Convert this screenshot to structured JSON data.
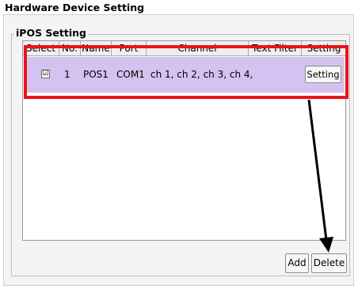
{
  "outer_title": "Hardware Device Setting",
  "group_title": "iPOS Setting",
  "columns": [
    "Select",
    "No.",
    "Name",
    "Port",
    "Channel",
    "Text Filter",
    "Setting"
  ],
  "row": {
    "checked_mark": "☑",
    "no": "1",
    "name": "POS1",
    "port": "COM1",
    "channel": "ch 1, ch 2, ch 3, ch 4,",
    "text_filter": "",
    "setting_label": "Setting"
  },
  "buttons": {
    "add": "Add",
    "delete": "Delete"
  },
  "colors": {
    "row_selected": "#d4c2f0",
    "highlight": "#e8141a",
    "arrow": "#000000"
  }
}
